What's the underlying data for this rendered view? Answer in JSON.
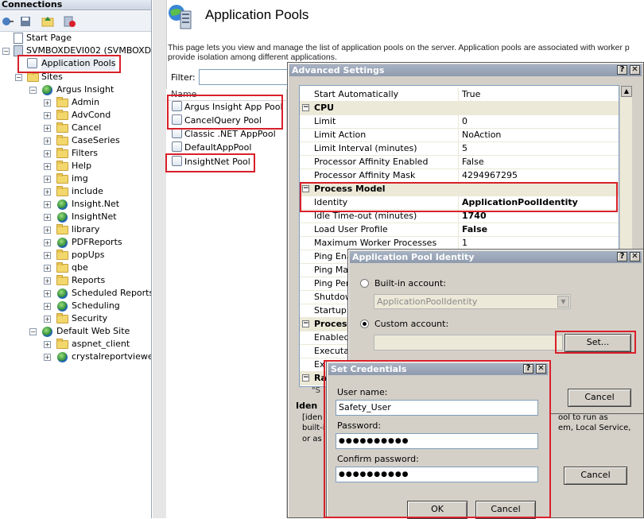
{
  "connections": {
    "title": "Connections",
    "tree": [
      {
        "label": "Start Page"
      },
      {
        "label": "SVMBOXDEVI002 (SVMBOXDEVIO"
      },
      {
        "label": "Application Pools"
      },
      {
        "label": "Sites"
      },
      {
        "label": "Argus Insight"
      },
      {
        "label": "Admin"
      },
      {
        "label": "AdvCond"
      },
      {
        "label": "Cancel"
      },
      {
        "label": "CaseSeries"
      },
      {
        "label": "Filters"
      },
      {
        "label": "Help"
      },
      {
        "label": "img"
      },
      {
        "label": "include"
      },
      {
        "label": "Insight.Net"
      },
      {
        "label": "InsightNet"
      },
      {
        "label": "library"
      },
      {
        "label": "PDFReports"
      },
      {
        "label": "popUps"
      },
      {
        "label": "qbe"
      },
      {
        "label": "Reports"
      },
      {
        "label": "Scheduled Reports"
      },
      {
        "label": "Scheduling"
      },
      {
        "label": "Security"
      },
      {
        "label": "Default Web Site"
      },
      {
        "label": "aspnet_client"
      },
      {
        "label": "crystalreportviewers"
      }
    ]
  },
  "main": {
    "title": "Application Pools",
    "description_line1": "This page lets you view and manage the list of application pools on the server. Application pools are associated with worker p",
    "description_line2": "provide isolation among different applications.",
    "filter_label": "Filter:",
    "list_header": "Name",
    "pools": [
      "Argus Insight App Pool",
      "CancelQuery Pool",
      "Classic .NET AppPool",
      "DefaultAppPool",
      "InsightNet Pool"
    ]
  },
  "advanced_settings": {
    "title": "Advanced Settings",
    "rows": [
      {
        "name": "Start Automatically",
        "value": "True"
      },
      {
        "name": "CPU",
        "value": ""
      },
      {
        "name": "Limit",
        "value": "0"
      },
      {
        "name": "Limit Action",
        "value": "NoAction"
      },
      {
        "name": "Limit Interval (minutes)",
        "value": "5"
      },
      {
        "name": "Processor Affinity Enabled",
        "value": "False"
      },
      {
        "name": "Processor Affinity Mask",
        "value": "4294967295"
      },
      {
        "name": "Process Model",
        "value": ""
      },
      {
        "name": "Identity",
        "value": "ApplicationPoolIdentity"
      },
      {
        "name": "Idle Time-out (minutes)",
        "value": "1740"
      },
      {
        "name": "Load User Profile",
        "value": "False"
      },
      {
        "name": "Maximum Worker Processes",
        "value": "1"
      },
      {
        "name": "Ping Enal",
        "value": ""
      },
      {
        "name": "Ping Max",
        "value": ""
      },
      {
        "name": "Ping Perio",
        "value": ""
      },
      {
        "name": "Shutdow",
        "value": ""
      },
      {
        "name": "Startup T",
        "value": ""
      },
      {
        "name": "Process",
        "value": ""
      },
      {
        "name": "Enabled",
        "value": ""
      },
      {
        "name": "Executab",
        "value": ""
      },
      {
        "name": "Ex",
        "value": ""
      },
      {
        "name": "Ra",
        "value": ""
      }
    ],
    "footer_title": "Iden",
    "footer_text1": "[iden",
    "footer_text2": "built-i",
    "footer_text3": "or as",
    "footer_right1": "ool to run as",
    "footer_right2": "em, Local Service,",
    "cancel_label": "Cancel",
    "partial_row_text": "\"S"
  },
  "identity_dialog": {
    "title": "Application Pool Identity",
    "builtin_label": "Built-in account:",
    "builtin_value": "ApplicationPoolIdentity",
    "custom_label": "Custom account:",
    "custom_value": "",
    "set_label": "Set...",
    "cancel_label": "Cancel"
  },
  "credentials_dialog": {
    "title": "Set Credentials",
    "username_label": "User name:",
    "username_value": "Safety_User",
    "password_label": "Password:",
    "password_value": "●●●●●●●●●●",
    "confirm_label": "Confirm password:",
    "confirm_value": "●●●●●●●●●●",
    "ok_label": "OK",
    "cancel_label": "Cancel"
  },
  "colors": {
    "highlight_red": "#d8202a",
    "dialog_bg": "#d4d0c8",
    "title_bar": "#8f9bad"
  },
  "icons": [
    "back-icon",
    "save-icon",
    "up-icon",
    "disconnect-icon",
    "start-page-icon",
    "server-icon",
    "app-pools-icon",
    "sites-icon",
    "globe-icon",
    "folder-icon",
    "pool-icon",
    "help-icon",
    "close-icon"
  ]
}
